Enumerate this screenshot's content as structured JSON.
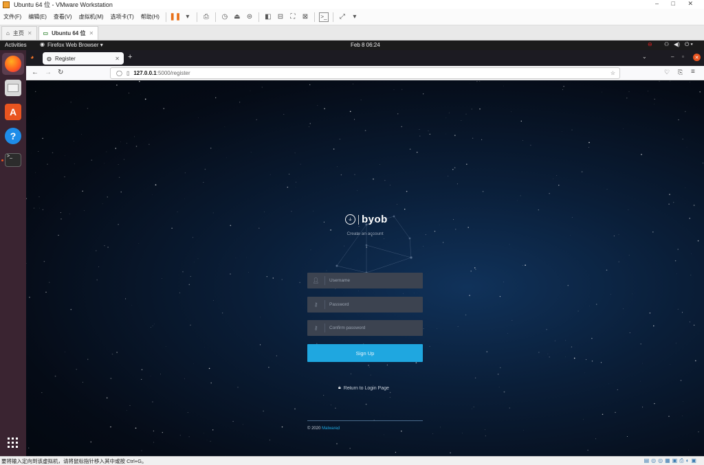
{
  "vm": {
    "title": "Ubuntu 64 位 - VMware Workstation",
    "window_controls": "– □ ✕",
    "menu": [
      "文件(F)",
      "编辑(E)",
      "查看(V)",
      "虚拟机(M)",
      "选项卡(T)",
      "帮助(H)"
    ],
    "tabs": [
      {
        "label": "主页"
      },
      {
        "label": "Ubuntu 64 位"
      }
    ],
    "status_text": "要将输入定向到该虚拟机，请将鼠标指针移入其中或按 Ctrl+G。"
  },
  "ubuntu": {
    "activities": "Activities",
    "app_name": "Firefox Web Browser",
    "clock": "Feb 8  06:24"
  },
  "firefox": {
    "tab_title": "Register",
    "url_host": "127.0.0.1",
    "url_rest": ":5000/register"
  },
  "page": {
    "brand": "byob",
    "subtitle": "Create an account",
    "username_placeholder": "Username",
    "password_placeholder": "Password",
    "confirm_placeholder": "Confirm password",
    "signup_label": "Sign Up",
    "login_link": "Return to Login Page",
    "footer_prefix": "© 2020",
    "footer_name": "Malwared"
  },
  "colors": {
    "accent": "#1fa7e0",
    "field_bg": "#3c4350",
    "dock_bg": "#3a2431"
  }
}
